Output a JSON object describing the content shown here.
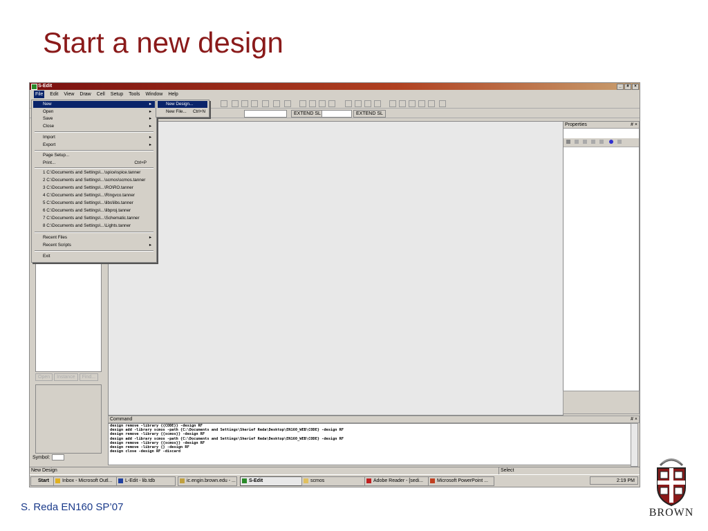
{
  "slide": {
    "title": "Start a new design",
    "footer": "S. Reda EN160 SP’07",
    "logo_text": "BROWN"
  },
  "window": {
    "title": "S-Edit",
    "menu": [
      "File",
      "Edit",
      "View",
      "Draw",
      "Cell",
      "Setup",
      "Tools",
      "Window",
      "Help"
    ]
  },
  "toolbar": {
    "extend_label_1": "EXTEND SL",
    "extend_label_2": "EXTEND SL"
  },
  "file_menu": {
    "items": [
      {
        "label": "New",
        "arrow": "▸"
      },
      {
        "label": "Open",
        "arrow": "▸"
      },
      {
        "label": "Save",
        "arrow": "▸"
      },
      {
        "label": "Close",
        "arrow": "▸"
      },
      {
        "label": "Import",
        "arrow": "▸"
      },
      {
        "label": "Export",
        "arrow": "▸"
      },
      {
        "label": "Page Setup..."
      },
      {
        "label": "Print...",
        "shortcut": "Ctrl+P"
      },
      {
        "label": "1 C:\\Documents and Settings\\...\\spice\\spice.tanner"
      },
      {
        "label": "2 C:\\Documents and Settings\\...\\scmos\\scmos.tanner"
      },
      {
        "label": "3 C:\\Documents and Settings\\...\\RO\\RO.tanner"
      },
      {
        "label": "4 C:\\Documents and Settings\\...\\Ringvco.tanner"
      },
      {
        "label": "5 C:\\Documents and Settings\\...\\libs\\libs.tanner"
      },
      {
        "label": "6 C:\\Documents and Settings\\...\\libproj.tanner"
      },
      {
        "label": "7 C:\\Documents and Settings\\...\\Schematic.tanner"
      },
      {
        "label": "8 C:\\Documents and Settings\\...\\Lights.tanner"
      },
      {
        "label": "Recent Files",
        "arrow": "▸"
      },
      {
        "label": "Recent Scripts",
        "arrow": "▸"
      },
      {
        "label": "Exit"
      }
    ]
  },
  "new_submenu": {
    "items": [
      {
        "label": "New Design..."
      },
      {
        "label": "New File...",
        "shortcut": "Ctrl+N"
      }
    ]
  },
  "left_panel": {
    "buttons": [
      "Open",
      "Instance",
      "Find..."
    ],
    "symbol_label": "Symbol:"
  },
  "properties": {
    "title": "Properties",
    "pin": "# ×"
  },
  "command": {
    "title": "Command",
    "pin": "# ×",
    "lines": [
      "design remove -library {{CODE}} -design RF",
      "design add -library scmos -path {C:\\Documents and Settings\\Sherief Reda\\Desktop\\EN160_WEB\\CODE} -design RF",
      "design remove -library {{scmos}} -design RF",
      "design add -library scmos -path {C:\\Documents and Settings\\Sherief Reda\\Desktop\\EN160_WEB\\CODE} -design RF",
      "design remove -library {{scmos}} -design RF",
      "design remove -library {} -design RF",
      "design close -design RF -discard"
    ]
  },
  "status": {
    "left": "New Design",
    "right": "Select"
  },
  "taskbar": {
    "start": "Start",
    "tasks": [
      "Inbox - Microsoft Outl...",
      "L-Edit - lib.tdb",
      "ic.engin.brown.edu - ...",
      "S-Edit",
      "scmos",
      "Adobe Reader - [sedi...",
      "Microsoft PowerPoint ..."
    ],
    "clock": "2:19 PM"
  },
  "colors": {
    "title_red": "#8a1a1a",
    "footer_blue": "#1a3a8a",
    "menu_highlight": "#0a246a"
  }
}
